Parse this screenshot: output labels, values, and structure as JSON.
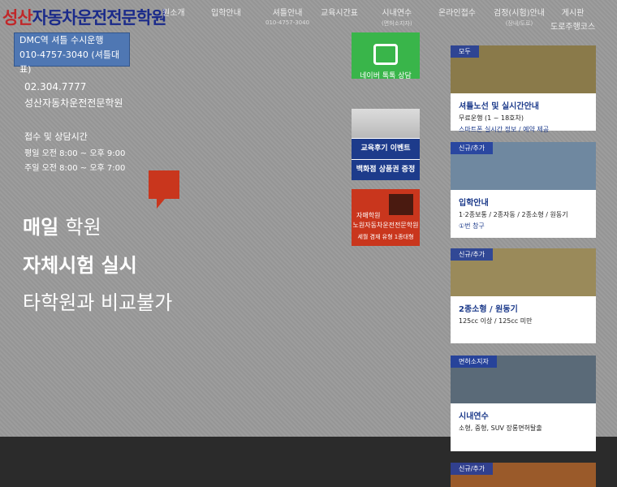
{
  "logo": {
    "title_red": "성산",
    "title_rest": "자동차운전전문학원"
  },
  "nav": [
    {
      "label": "원소개",
      "sub": ""
    },
    {
      "label": "입학안내",
      "sub": ""
    },
    {
      "label": "셔틀안내",
      "sub": "010-4757-3040"
    },
    {
      "label": "교육시간표",
      "sub": ""
    },
    {
      "label": "시내연수",
      "sub": "(면허소지자)"
    },
    {
      "label": "온라인접수",
      "sub": ""
    },
    {
      "label": "검정(시험)안내",
      "sub": "(장내/도로)"
    },
    {
      "label": "게시판",
      "sub": "도로주행코스"
    }
  ],
  "shuttle": {
    "line1": "DMC역 셔틀 수시운행",
    "line2": "010-4757-3040 (셔틀대표)"
  },
  "info": {
    "phone": "02.304.7777",
    "name": "성산자동차운전전문학원",
    "hours_title": "접수 및 상담시간",
    "weekday": "평일   오전 8:00 ~ 오후 9:00",
    "weekend": "주일   오전 8:00 ~ 오후 7:00"
  },
  "headline": {
    "line1_bold": "매일",
    "line1_light": "학원",
    "line2": "자체시험 실시",
    "line3": "타학원과 비교불가"
  },
  "talk": {
    "label": "네이버 톡톡 상담"
  },
  "event": {
    "line1": "교육후기 이벤트",
    "line2": "백화점 상품권 증정"
  },
  "redcard": {
    "t1": "자매학원",
    "t2": "노원자동차운전전문학원",
    "t3": "세월 겸재 유형  1종대형"
  },
  "right_cards": [
    {
      "tag": "모두",
      "title": "셔틀노선 및 실시간안내",
      "d1": "무료운행 (1 ~ 18호차)",
      "d2": "스마트폰 실시간 정보 / 예약 제공",
      "bg": "#8a7a4a"
    },
    {
      "tag": "신규/추가",
      "title": "입학안내",
      "d1": "1·2종보통 / 2종자동 / 2종소형 / 원동기",
      "d2": "①번 창구",
      "bg": "#6f88a0"
    },
    {
      "tag": "신규/추가",
      "title": "2종소형 / 원동기",
      "d1": "125cc 이상 / 125cc 미만",
      "d2": "",
      "bg": "#9a8a5a"
    },
    {
      "tag": "면허소지자",
      "title": "시내연수",
      "d1": "소형, 중형, SUV 장롱면허탈출",
      "d2": "",
      "bg": "#5a6a78"
    },
    {
      "tag": "신규/추가",
      "title": "",
      "d1": "",
      "d2": "",
      "bg": "#9a5a2a"
    }
  ]
}
